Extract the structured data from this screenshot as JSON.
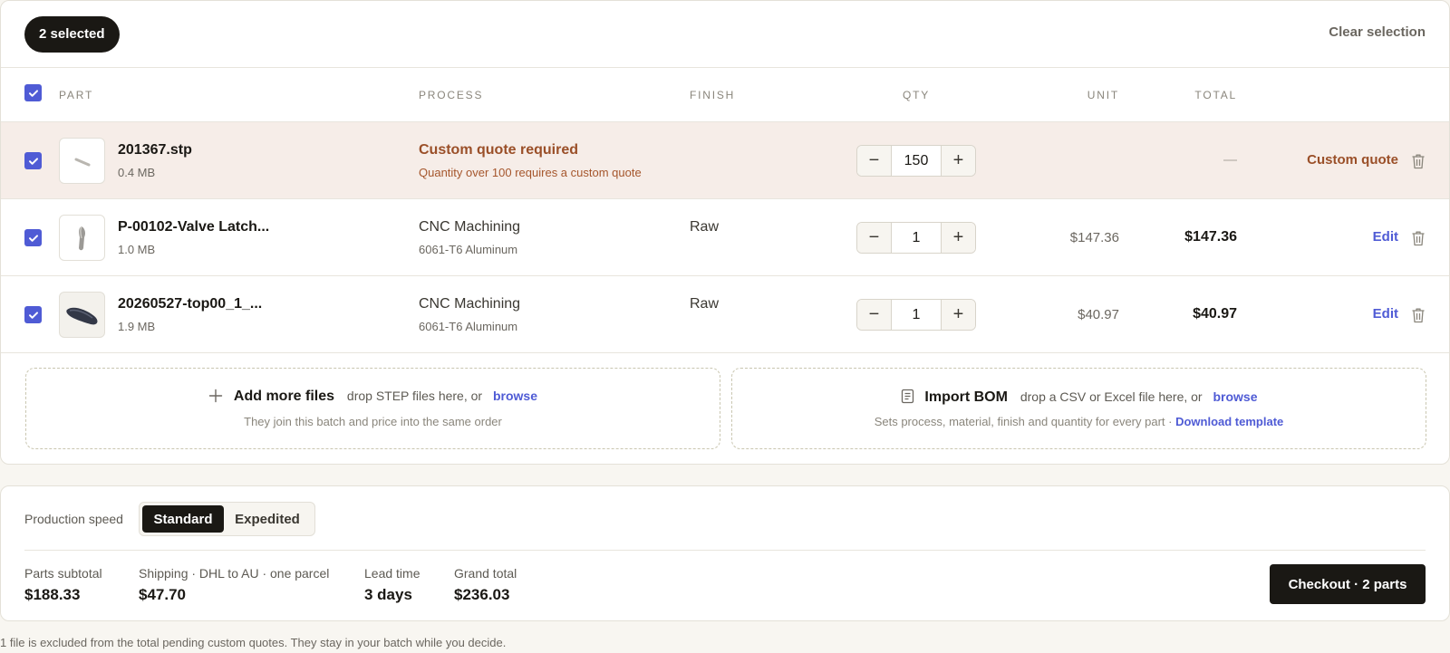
{
  "selection": {
    "count_label": "2 selected",
    "clear_label": "Clear selection"
  },
  "columns": {
    "part": "PART",
    "process": "PROCESS",
    "finish": "FINISH",
    "qty": "QTY",
    "unit": "UNIT",
    "total": "TOTAL"
  },
  "rows": [
    {
      "name": "201367.stp",
      "size": "0.4 MB",
      "process": "Custom quote required",
      "sub": "Quantity over 100 requires a custom quote",
      "finish": "",
      "qty": "150",
      "unit": "",
      "total": "—",
      "action": "Custom quote"
    },
    {
      "name": "P-00102-Valve Latch...",
      "size": "1.0 MB",
      "process": "CNC Machining",
      "sub": "6061-T6 Aluminum",
      "finish": "Raw",
      "qty": "1",
      "unit": "$147.36",
      "total": "$147.36",
      "action": "Edit"
    },
    {
      "name": "20260527-top00_1_...",
      "size": "1.9 MB",
      "process": "CNC Machining",
      "sub": "6061-T6 Aluminum",
      "finish": "Raw",
      "qty": "1",
      "unit": "$40.97",
      "total": "$40.97",
      "action": "Edit"
    }
  ],
  "stepper": {
    "minus": "−",
    "plus": "+"
  },
  "add_files": {
    "title": "Add more files",
    "hint": "drop STEP files here, or",
    "link": "browse",
    "sub": "They join this batch and price into the same order"
  },
  "import_bom": {
    "title": "Import BOM",
    "hint": "drop a CSV or Excel file here, or",
    "link": "browse",
    "sub": "Sets process, material, finish and quantity for every part ·",
    "sub_link": "Download template"
  },
  "summary": {
    "speed_label": "Production speed",
    "speed_options": [
      "Standard",
      "Expedited"
    ],
    "selected_speed": "Standard",
    "subtotal_label": "Parts subtotal",
    "subtotal": "$188.33",
    "shipping_label": "Shipping · DHL to AU · one parcel",
    "shipping": "$47.70",
    "lead_label": "Lead time",
    "lead": "3 days",
    "grand_label": "Grand total",
    "grand": "$236.03",
    "checkout_label": "Checkout · 2 parts"
  },
  "footnote": "1 file is excluded from the total pending custom quotes. They stay in your batch while you decide.",
  "colors": {
    "accent": "#4f5bd5",
    "dark": "#1a1814",
    "warning": "#9a4f28",
    "warning_bg": "#f6ede8"
  }
}
